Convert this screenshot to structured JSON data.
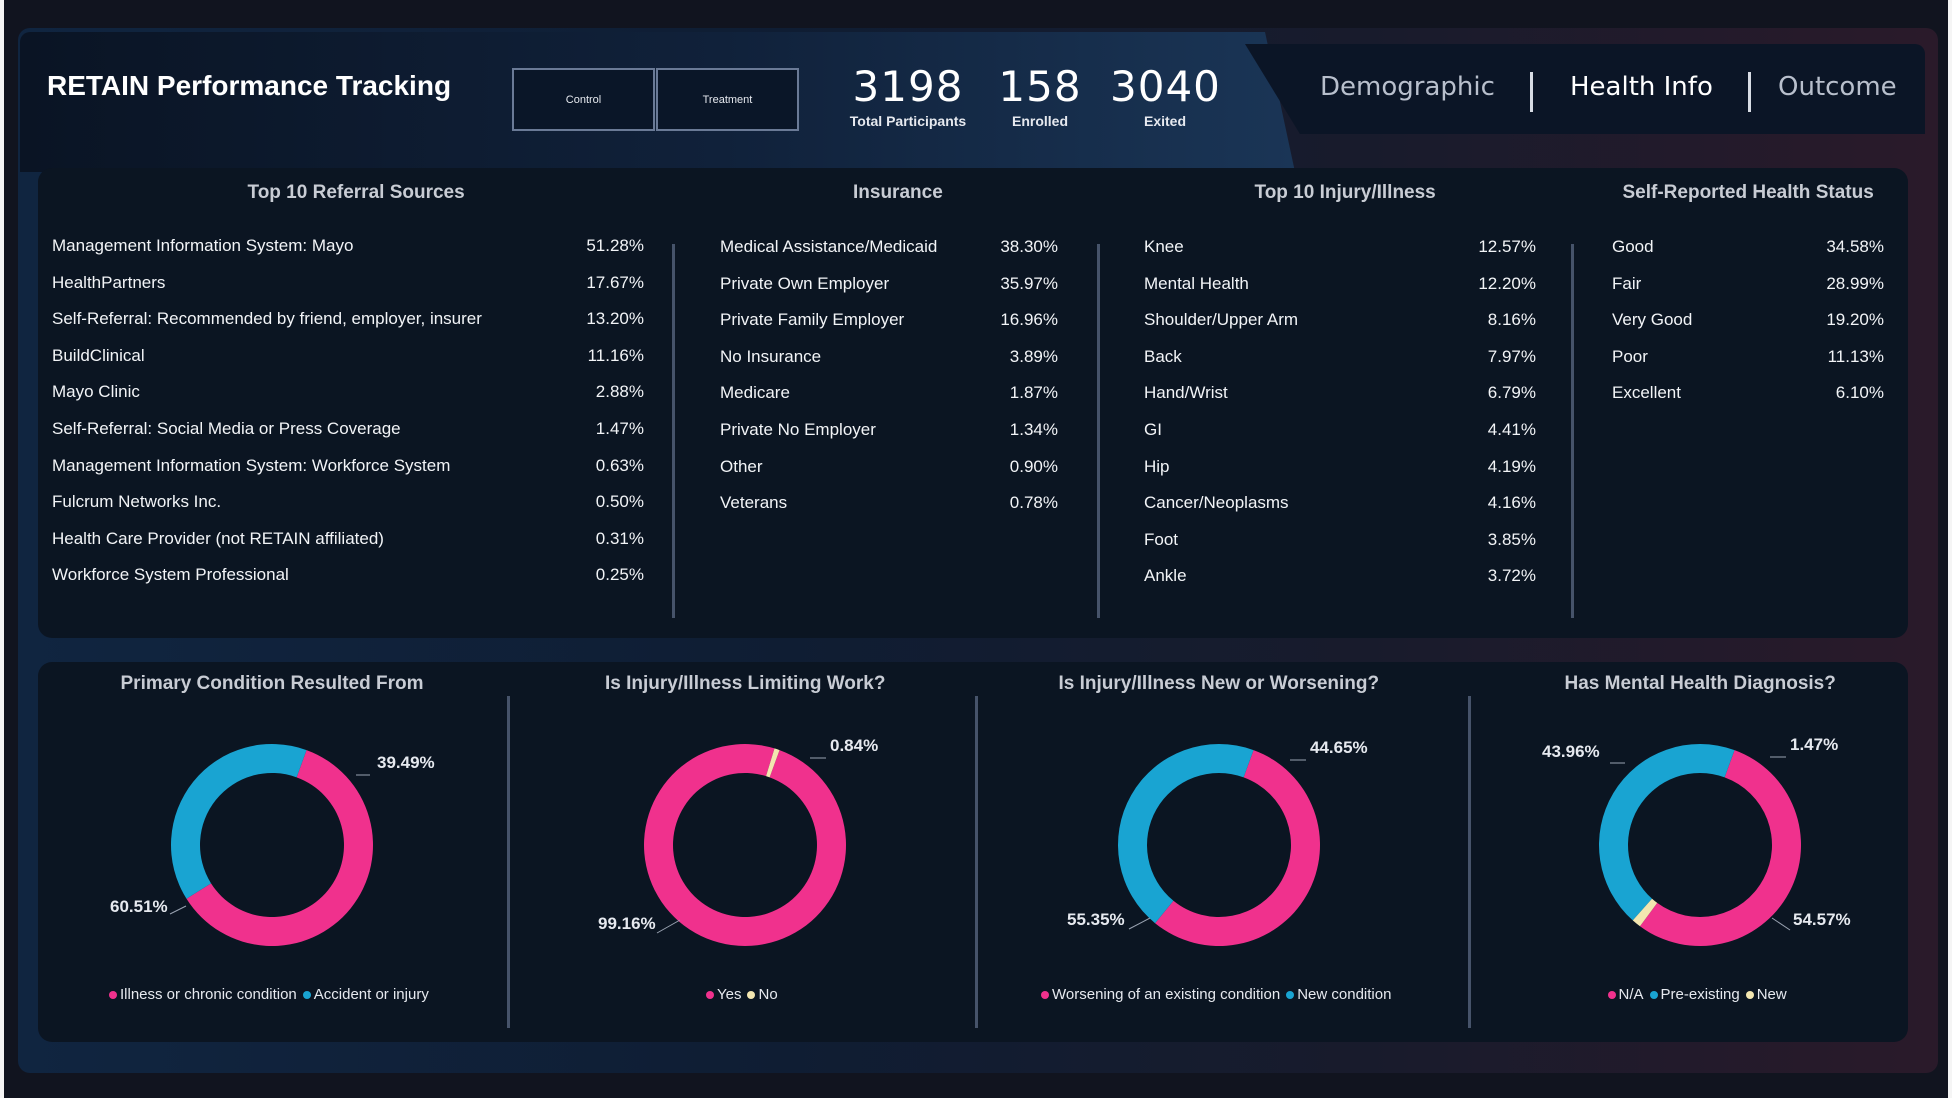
{
  "colors": {
    "pink": "#f0318d",
    "blue": "#19a4d2",
    "cream": "#f3e6b0"
  },
  "header": {
    "title": "RETAIN Performance Tracking",
    "slicers": [
      "Control",
      "Treatment"
    ],
    "kpis": [
      {
        "value": "3198",
        "label": "Total Participants"
      },
      {
        "value": "158",
        "label": "Enrolled"
      },
      {
        "value": "3040",
        "label": "Exited"
      }
    ],
    "tabs": [
      "Demographic",
      "Health Info",
      "Outcome"
    ]
  },
  "referral": {
    "title": "Top 10 Referral Sources",
    "rows": [
      {
        "label": "Management Information System: Mayo",
        "value": "51.28%"
      },
      {
        "label": "HealthPartners",
        "value": "17.67%"
      },
      {
        "label": "Self-Referral: Recommended by friend, employer, insurer",
        "value": "13.20%"
      },
      {
        "label": "BuildClinical",
        "value": "11.16%"
      },
      {
        "label": "Mayo Clinic",
        "value": "2.88%"
      },
      {
        "label": "Self-Referral: Social Media or Press Coverage",
        "value": "1.47%"
      },
      {
        "label": "Management Information System: Workforce System",
        "value": "0.63%"
      },
      {
        "label": "Fulcrum Networks Inc.",
        "value": "0.50%"
      },
      {
        "label": "Health Care Provider (not RETAIN affiliated)",
        "value": "0.31%"
      },
      {
        "label": "Workforce System Professional",
        "value": "0.25%"
      }
    ]
  },
  "insurance": {
    "title": "Insurance",
    "rows": [
      {
        "label": "Medical Assistance/Medicaid",
        "value": "38.30%"
      },
      {
        "label": "Private Own Employer",
        "value": "35.97%"
      },
      {
        "label": "Private Family Employer",
        "value": "16.96%"
      },
      {
        "label": "No Insurance",
        "value": "3.89%"
      },
      {
        "label": "Medicare",
        "value": "1.87%"
      },
      {
        "label": "Private No Employer",
        "value": "1.34%"
      },
      {
        "label": "Other",
        "value": "0.90%"
      },
      {
        "label": "Veterans",
        "value": "0.78%"
      }
    ]
  },
  "injury": {
    "title": "Top 10 Injury/Illness",
    "rows": [
      {
        "label": "Knee",
        "value": "12.57%"
      },
      {
        "label": "Mental Health",
        "value": "12.20%"
      },
      {
        "label": "Shoulder/Upper Arm",
        "value": "8.16%"
      },
      {
        "label": "Back",
        "value": "7.97%"
      },
      {
        "label": "Hand/Wrist",
        "value": "6.79%"
      },
      {
        "label": "GI",
        "value": "4.41%"
      },
      {
        "label": "Hip",
        "value": "4.19%"
      },
      {
        "label": "Cancer/Neoplasms",
        "value": "4.16%"
      },
      {
        "label": "Foot",
        "value": "3.85%"
      },
      {
        "label": "Ankle",
        "value": "3.72%"
      }
    ]
  },
  "health_status": {
    "title": "Self-Reported Health Status",
    "rows": [
      {
        "label": "Good",
        "value": "34.58%"
      },
      {
        "label": "Fair",
        "value": "28.99%"
      },
      {
        "label": "Very Good",
        "value": "19.20%"
      },
      {
        "label": "Poor",
        "value": "11.13%"
      },
      {
        "label": "Excellent",
        "value": "6.10%"
      }
    ]
  },
  "chart_data": [
    {
      "type": "pie",
      "title": "Primary Condition Resulted From",
      "labels": [
        "Illness or chronic condition",
        "Accident or injury"
      ],
      "values": [
        60.51,
        39.49
      ],
      "value_labels": [
        "60.51%",
        "39.49%"
      ],
      "colors": [
        "#f0318d",
        "#19a4d2"
      ],
      "legend": "bottom"
    },
    {
      "type": "pie",
      "title": "Is Injury/Illness Limiting Work?",
      "labels": [
        "Yes",
        "No"
      ],
      "values": [
        99.16,
        0.84
      ],
      "value_labels": [
        "99.16%",
        "0.84%"
      ],
      "colors": [
        "#f0318d",
        "#f3e6b0"
      ],
      "legend": "bottom"
    },
    {
      "type": "pie",
      "title": "Is Injury/Illness New or Worsening?",
      "labels": [
        "Worsening of an existing condition",
        "New condition"
      ],
      "values": [
        55.35,
        44.65
      ],
      "value_labels": [
        "55.35%",
        "44.65%"
      ],
      "colors": [
        "#f0318d",
        "#19a4d2"
      ],
      "legend": "bottom"
    },
    {
      "type": "pie",
      "title": "Has Mental Health Diagnosis?",
      "labels": [
        "N/A",
        "Pre-existing",
        "New"
      ],
      "values": [
        54.57,
        43.96,
        1.47
      ],
      "value_labels": [
        "54.57%",
        "43.96%",
        "1.47%"
      ],
      "colors": [
        "#f0318d",
        "#19a4d2",
        "#f3e6b0"
      ],
      "legend": "bottom"
    }
  ]
}
